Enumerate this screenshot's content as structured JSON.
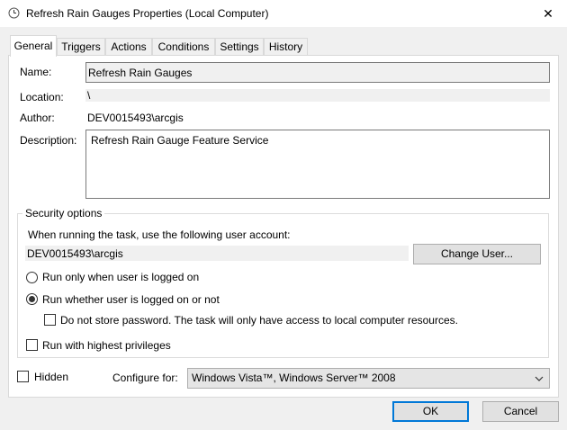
{
  "window": {
    "title": "Refresh Rain Gauges Properties (Local Computer)",
    "icon": "task-scheduler-clock-icon",
    "close_glyph": "✕"
  },
  "tabs": [
    {
      "label": "General",
      "active": true
    },
    {
      "label": "Triggers",
      "active": false
    },
    {
      "label": "Actions",
      "active": false
    },
    {
      "label": "Conditions",
      "active": false
    },
    {
      "label": "Settings",
      "active": false
    },
    {
      "label": "History",
      "active": false
    }
  ],
  "general": {
    "name_label": "Name:",
    "name_value": "Refresh Rain Gauges",
    "location_label": "Location:",
    "location_value": "\\",
    "author_label": "Author:",
    "author_value": "DEV0015493\\arcgis",
    "description_label": "Description:",
    "description_value": "Refresh Rain Gauge Feature Service"
  },
  "security": {
    "legend": "Security options",
    "account_prompt": "When running the task, use the following user account:",
    "account_value": "DEV0015493\\arcgis",
    "change_user_label": "Change User...",
    "radio_logged_on_label": "Run only when user is logged on",
    "radio_logged_on_selected": false,
    "radio_whether_label": "Run whether user is logged on or not",
    "radio_whether_selected": true,
    "no_store_password_label": "Do not store password.  The task will only have access to local computer resources.",
    "no_store_password_checked": false,
    "highest_privileges_label": "Run with highest privileges",
    "highest_privileges_checked": false
  },
  "bottom": {
    "hidden_label": "Hidden",
    "hidden_checked": false,
    "configure_label": "Configure for:",
    "configure_value": "Windows Vista™, Windows Server™ 2008"
  },
  "buttons": {
    "ok_label": "OK",
    "cancel_label": "Cancel"
  },
  "colors": {
    "default_button_border": "#0078d7",
    "readonly_field_bg": "#f0f0f0"
  }
}
